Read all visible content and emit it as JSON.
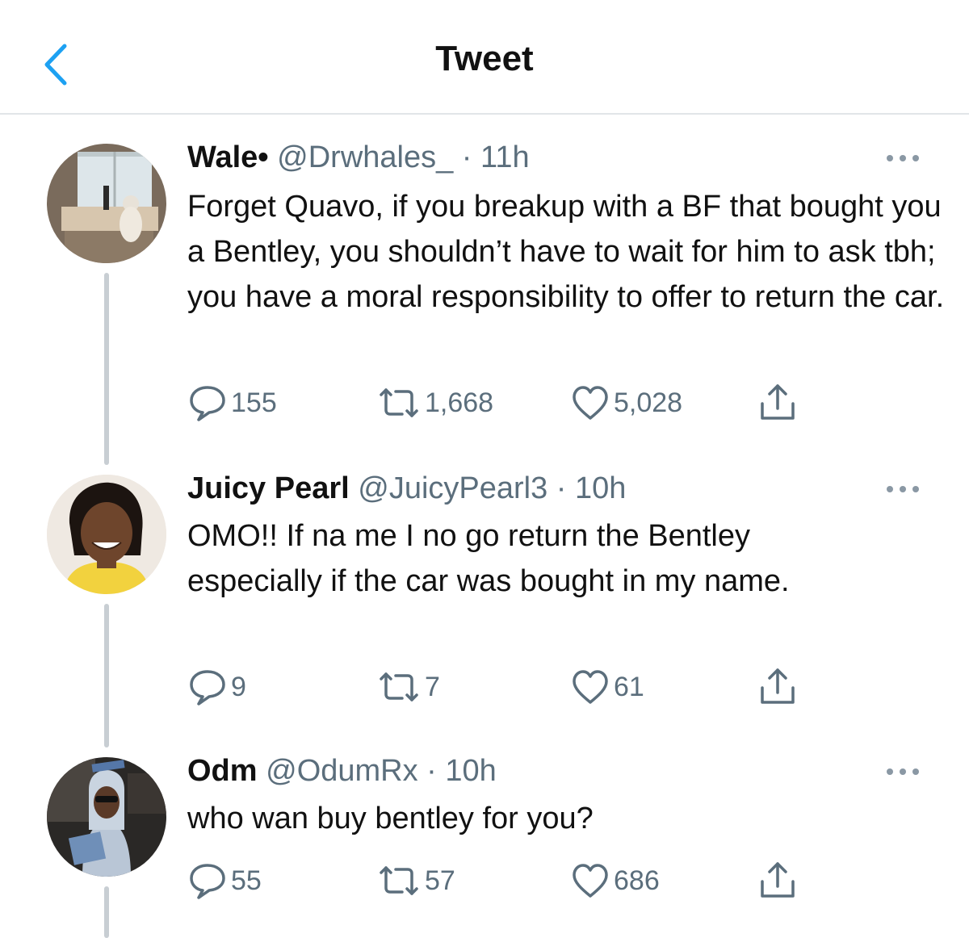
{
  "header": {
    "title": "Tweet",
    "back_icon": "chevron-left-icon"
  },
  "colors": {
    "accent": "#1da1f2",
    "secondary_text": "#5b6e7c",
    "thread_line": "#c8ced3"
  },
  "tweets": [
    {
      "name": "Wale",
      "bullet": "•",
      "handle": "@Drwhales_",
      "sep": " · ",
      "time": "11h",
      "text": "Forget Quavo, if you breakup with a BF that bought you a Bentley, you shouldn’t have to wait for him to ask tbh; you have a moral responsibility to offer to return the car.",
      "replies": "155",
      "retweets": "1,668",
      "likes": "5,028"
    },
    {
      "name": "Juicy Pearl",
      "handle": "@JuicyPearl3",
      "sep": " · ",
      "time": "10h",
      "text": "OMO!! If na me I no go return the Bentley especially if the car was bought in my name.",
      "replies": "9",
      "retweets": "7",
      "likes": "61"
    },
    {
      "name": "Odm",
      "handle": "@OdumRx",
      "sep": " · ",
      "time": "10h",
      "text": "who wan buy bentley for you?",
      "replies": "55",
      "retweets": "57",
      "likes": "686"
    }
  ]
}
